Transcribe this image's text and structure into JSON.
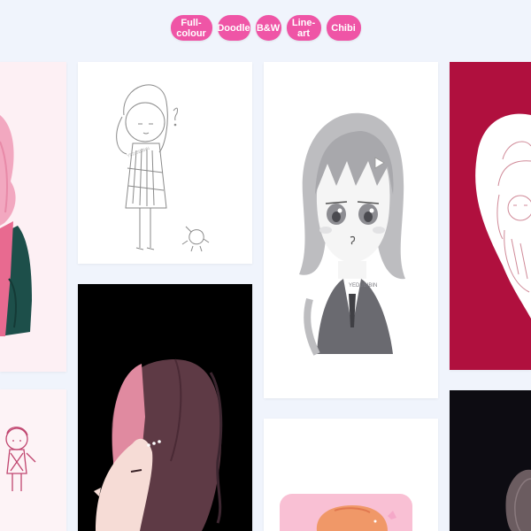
{
  "filters": [
    {
      "label": "Full-colour"
    },
    {
      "label": "Doodle"
    },
    {
      "label": "B&W"
    },
    {
      "label": "Line-art"
    },
    {
      "label": "Chibi"
    }
  ],
  "gallery": {
    "watermark": "YEDUBIBIN"
  },
  "colors": {
    "accent": "#ef55a6",
    "page_bg": "#f0f4fc",
    "crimson_card": "#b0103e",
    "dark_card": "#0d0c12"
  }
}
